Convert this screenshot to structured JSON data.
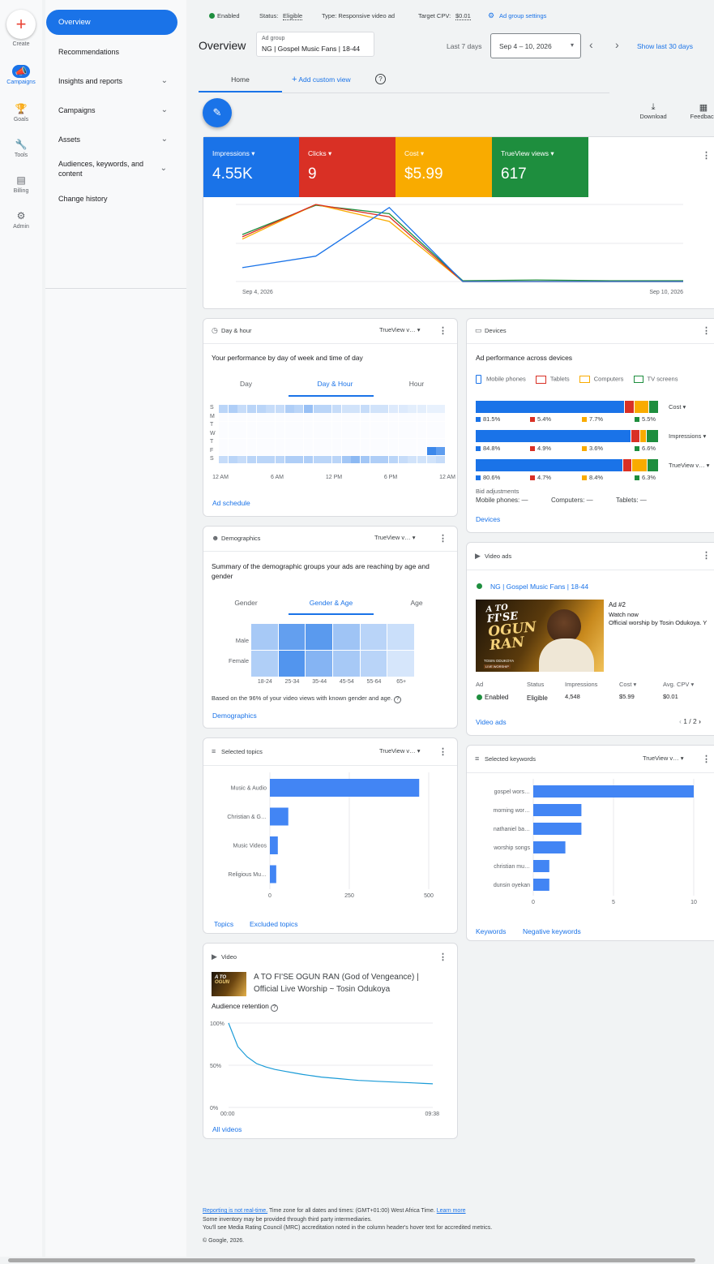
{
  "rail": {
    "create": "Create",
    "campaigns": "Campaigns",
    "goals": "Goals",
    "tools": "Tools",
    "billing": "Billing",
    "admin": "Admin"
  },
  "nav": {
    "overview": "Overview",
    "recommendations": "Recommendations",
    "insights": "Insights and reports",
    "campaigns": "Campaigns",
    "assets": "Assets",
    "audiences": "Audiences, keywords, and content",
    "history": "Change history"
  },
  "status_bar": {
    "enabled": "Enabled",
    "status_label": "Status:",
    "status_value": "Eligible",
    "type": "Type: Responsive video ad",
    "cpv_label": "Target CPV:",
    "cpv_value": "$0.01",
    "settings": "Ad group settings"
  },
  "header": {
    "title": "Overview",
    "adgroup_label": "Ad group",
    "adgroup_value": "NG | Gospel Music Fans | 18-44",
    "range_label": "Last 7 days",
    "range_value": "Sep 4 – 10, 2026",
    "show_last": "Show last 30 days"
  },
  "tabs": {
    "home": "Home",
    "add_view": "Add custom view"
  },
  "actions": {
    "download": "Download",
    "feedback": "Feedback"
  },
  "metrics": [
    {
      "label": "Impressions",
      "value": "4.55K",
      "color": "#1a73e8"
    },
    {
      "label": "Clicks",
      "value": "9",
      "color": "#d93025"
    },
    {
      "label": "Cost",
      "value": "$5.99",
      "color": "#f9ab00"
    },
    {
      "label": "TrueView views",
      "value": "617",
      "color": "#1e8e3e"
    }
  ],
  "chart_data": {
    "type": "line",
    "x_start_label": "Sep 4, 2026",
    "x_end_label": "Sep 10, 2026",
    "x": [
      "Sep 4",
      "Sep 5",
      "Sep 6",
      "Sep 7",
      "Sep 8",
      "Sep 9",
      "Sep 10"
    ],
    "series": [
      {
        "name": "Impressions",
        "color": "#1a73e8",
        "values": [
          0.18,
          0.33,
          0.96,
          0.0,
          0.0,
          0.0,
          0.0
        ]
      },
      {
        "name": "Clicks",
        "color": "#d93025",
        "values": [
          0.58,
          1.0,
          0.84,
          0.0,
          0.0,
          0.0,
          0.0
        ]
      },
      {
        "name": "Cost",
        "color": "#f9ab00",
        "values": [
          0.55,
          1.0,
          0.78,
          0.0,
          0.0,
          0.0,
          0.0
        ]
      },
      {
        "name": "TrueView views",
        "color": "#1e8e3e",
        "values": [
          0.61,
          0.99,
          0.88,
          0.01,
          0.02,
          0.01,
          0.01
        ]
      }
    ]
  },
  "dayhour": {
    "title": "Day & hour",
    "metric": "TrueView v…",
    "subtitle": "Your performance by day of week and time of day",
    "tabs": [
      "Day",
      "Day & Hour",
      "Hour"
    ],
    "days": [
      "S",
      "M",
      "T",
      "W",
      "T",
      "F",
      "S"
    ],
    "hours": [
      "12 AM",
      "6 AM",
      "12 PM",
      "6 PM",
      "12 AM"
    ],
    "link": "Ad schedule"
  },
  "devices": {
    "title": "Devices",
    "subtitle": "Ad performance across devices",
    "legend": [
      "Mobile phones",
      "Tablets",
      "Computers",
      "TV screens"
    ],
    "rows": [
      {
        "metric": "Cost",
        "values": [
          81.5,
          5.4,
          7.7,
          5.5
        ],
        "labels": [
          "81.5%",
          "5.4%",
          "7.7%",
          "5.5%"
        ]
      },
      {
        "metric": "Impressions",
        "values": [
          84.8,
          4.9,
          3.6,
          6.6
        ],
        "labels": [
          "84.8%",
          "4.9%",
          "3.6%",
          "6.6%"
        ]
      },
      {
        "metric": "TrueView v…",
        "values": [
          80.6,
          4.7,
          8.4,
          6.3
        ],
        "labels": [
          "80.6%",
          "4.7%",
          "8.4%",
          "6.3%"
        ]
      }
    ],
    "bid_title": "Bid adjustments",
    "bid_mobile": "Mobile phones: —",
    "bid_computers": "Computers: —",
    "bid_tablets": "Tablets: —",
    "link": "Devices"
  },
  "demographics": {
    "title": "Demographics",
    "metric": "TrueView v…",
    "subtitle": "Summary of the demographic groups your ads are reaching by age and gender",
    "tabs": [
      "Gender",
      "Gender & Age",
      "Age"
    ],
    "rows": [
      "Male",
      "Female"
    ],
    "ages": [
      "18-24",
      "25-34",
      "35-44",
      "45-54",
      "55-64",
      "65+"
    ],
    "intensity": [
      [
        0.35,
        0.75,
        0.8,
        0.4,
        0.25,
        0.15
      ],
      [
        0.3,
        0.85,
        0.55,
        0.35,
        0.25,
        0.08
      ]
    ],
    "note": "Based on the 96% of your video views with known gender and age.",
    "link": "Demographics"
  },
  "videoads": {
    "title": "Video ads",
    "adgroup": "NG | Gospel Music Fans | 18-44",
    "ad_name": "Ad #2",
    "watch": "Watch now",
    "desc": "Official worship by Tosin Odukoya. Y",
    "thumb_line1": "A TO",
    "thumb_line2": "FI'SE",
    "thumb_line3": "OGUN",
    "thumb_line4": "RAN",
    "thumb_artist": "TOSIN ODUKOYA",
    "thumb_tag": "LIVE WORSHIP",
    "cols": [
      "Ad",
      "Status",
      "Impressions",
      "Cost",
      "Avg. CPV"
    ],
    "vals": [
      "Enabled",
      "Eligible",
      "4,548",
      "$5.99",
      "$0.01"
    ],
    "link": "Video ads",
    "pager": "1 / 2"
  },
  "topics": {
    "title": "Selected topics",
    "metric": "TrueView v…",
    "chart": {
      "type": "bar",
      "categories": [
        "Music & Audio",
        "Christian & G…",
        "Music Videos",
        "Religious Mu…"
      ],
      "values": [
        470,
        58,
        25,
        20
      ],
      "xlim": [
        0,
        500
      ],
      "ticks": [
        "0",
        "250",
        "500"
      ]
    },
    "link1": "Topics",
    "link2": "Excluded topics"
  },
  "keywords": {
    "title": "Selected keywords",
    "metric": "TrueView v…",
    "chart": {
      "type": "bar",
      "categories": [
        "gospel wors…",
        "morning wor…",
        "nathaniel ba…",
        "worship songs",
        "christian mu…",
        "dunsin oyekan"
      ],
      "values": [
        10,
        3,
        3,
        2,
        1,
        1
      ],
      "xlim": [
        0,
        10
      ],
      "ticks": [
        "0",
        "5",
        "10"
      ]
    },
    "link1": "Keywords",
    "link2": "Negative keywords"
  },
  "video": {
    "title": "Video",
    "name_line1": "A TO FI'SE OGUN RAN (God of Vengeance) |",
    "name_line2": "Official Live Worship ~ Tosin Odukoya",
    "retention_label": "Audience retention",
    "y_ticks": [
      "100%",
      "50%",
      "0%"
    ],
    "x_start": "00:00",
    "x_end": "09:38",
    "link": "All videos",
    "retention_values": [
      100,
      72,
      60,
      52,
      48,
      45,
      43,
      41,
      39,
      37.5,
      36,
      35,
      34,
      33,
      32,
      31.5,
      31,
      30.5,
      30,
      29.5,
      29,
      28.5,
      28
    ]
  },
  "footer": {
    "line1_link": "Reporting is not real-time.",
    "line1_text": " Time zone for all dates and times: (GMT+01:00) West Africa Time. ",
    "line1_link2": "Learn more",
    "line2": "Some inventory may be provided through third party intermediaries.",
    "line3": "You'll see Media Rating Council (MRC) accreditation noted in the column header's hover text for accredited metrics.",
    "line4": "© Google, 2026."
  }
}
